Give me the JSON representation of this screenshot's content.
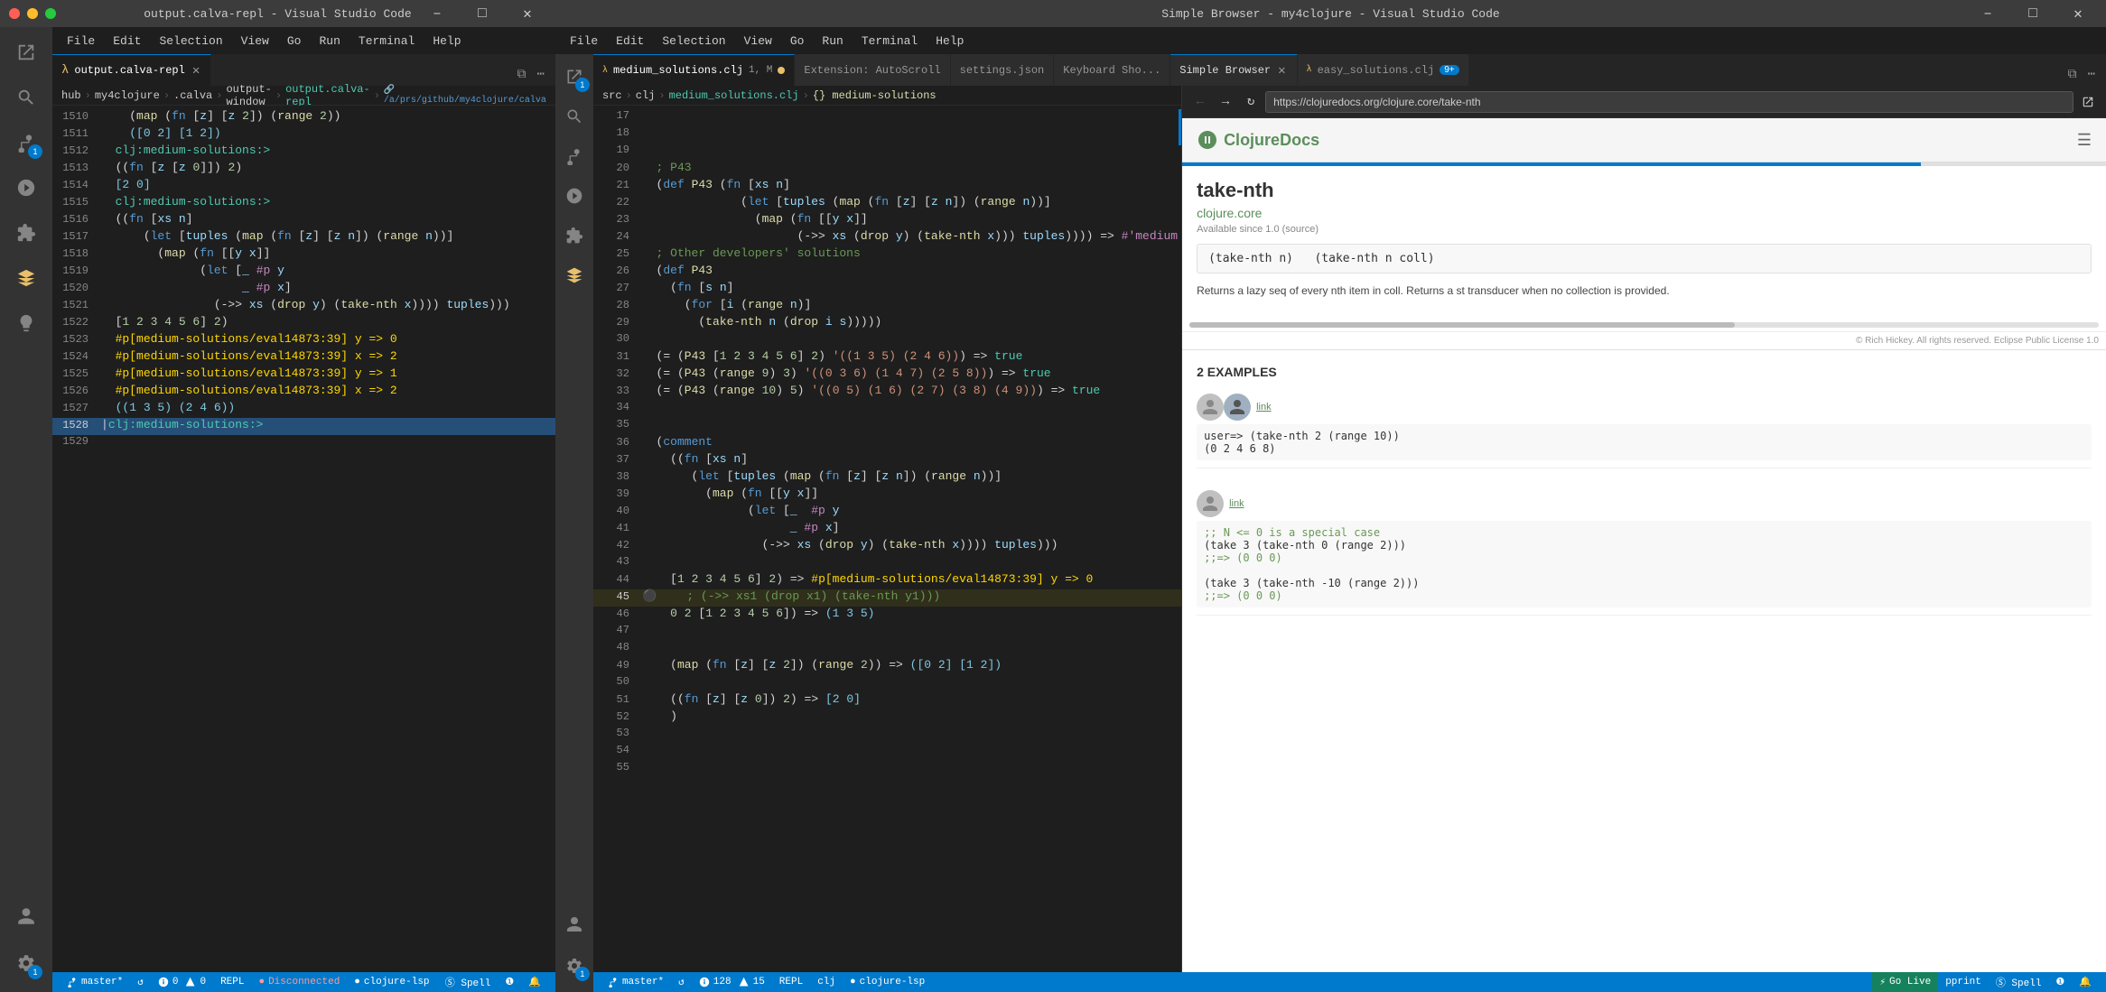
{
  "windows": {
    "left": {
      "title": "output.calva-repl - Visual Studio Code"
    },
    "right": {
      "title": "Simple Browser - my4clojure - Visual Studio Code"
    }
  },
  "menus": {
    "items": [
      "File",
      "Edit",
      "Selection",
      "View",
      "Go",
      "Run",
      "Terminal",
      "Help"
    ]
  },
  "left_tabs": [
    {
      "id": "output-calva-repl",
      "label": "output.calva-repl",
      "modified": false,
      "active": true
    }
  ],
  "right_tabs": [
    {
      "id": "medium-solutions",
      "label": "medium_solutions.clj",
      "info": "1, M",
      "modified": true,
      "active": true
    },
    {
      "id": "autoscroll",
      "label": "Extension: AutoScroll",
      "modified": false
    },
    {
      "id": "settings",
      "label": "settings.json",
      "modified": false
    },
    {
      "id": "keyboard",
      "label": "Keyboard Sho...",
      "modified": false
    },
    {
      "id": "simple-browser",
      "label": "Simple Browser",
      "active_secondary": true
    },
    {
      "id": "easy-solutions",
      "label": "easy_solutions.clj",
      "info": "9+"
    }
  ],
  "left_breadcrumb": [
    "hub",
    "my4clojure",
    ".calva",
    "output-window",
    "output.calva-repl"
  ],
  "center_breadcrumb": [
    "src",
    "clj",
    "medium_solutions.clj",
    "{} medium-solutions"
  ],
  "left_code": [
    {
      "num": "1510",
      "content": "    (map (fn [z] [z 2]) (range 2))"
    },
    {
      "num": "1511",
      "content": "    ([0 2] [1 2])"
    },
    {
      "num": "1512",
      "content": "  clj:medium-solutions:>"
    },
    {
      "num": "1513",
      "content": "  ((fn [z [z 0]]) 2)"
    },
    {
      "num": "1514",
      "content": "  [2 0]"
    },
    {
      "num": "1515",
      "content": "  clj:medium-solutions:>"
    },
    {
      "num": "1516",
      "content": "  ((fn [xs n]"
    },
    {
      "num": "1517",
      "content": "      (let [tuples (map (fn [z] [z n]) (range n))]"
    },
    {
      "num": "1518",
      "content": "        (map (fn [[y x]]"
    },
    {
      "num": "1519",
      "content": "              (let [_ #p y"
    },
    {
      "num": "1520",
      "content": "                    _ #p x]"
    },
    {
      "num": "1521",
      "content": "                (->> xs (drop y) (take-nth x)))) tuples)))"
    },
    {
      "num": "1522",
      "content": "  [1 2 3 4 5 6] 2)"
    },
    {
      "num": "1523",
      "content": "  #p[medium-solutions/eval14873:39] y => 0"
    },
    {
      "num": "1524",
      "content": "  #p[medium-solutions/eval14873:39] x => 2"
    },
    {
      "num": "1525",
      "content": "  #p[medium-solutions/eval14873:39] y => 1"
    },
    {
      "num": "1526",
      "content": "  #p[medium-solutions/eval14873:39] x => 2"
    },
    {
      "num": "1527",
      "content": "  ((1 3 5) (2 4 6))"
    },
    {
      "num": "1528",
      "content": "  clj:medium-solutions:>",
      "active_cursor": true
    },
    {
      "num": "1529",
      "content": ""
    }
  ],
  "center_code": [
    {
      "num": "17",
      "content": ""
    },
    {
      "num": "18",
      "content": ""
    },
    {
      "num": "19",
      "content": ""
    },
    {
      "num": "20",
      "content": "  ; P43"
    },
    {
      "num": "21",
      "content": "  (def P43 (fn [xs n]"
    },
    {
      "num": "22",
      "content": "              (let [tuples (map (fn [z] [z n]) (range n))]"
    },
    {
      "num": "23",
      "content": "                (map (fn [[y x]]"
    },
    {
      "num": "24",
      "content": "                      (->> xs (drop y) (take-nth x))) tuples)))) => #'medium"
    },
    {
      "num": "25",
      "content": "  ; Other developers' solutions"
    },
    {
      "num": "26",
      "content": "  (def P43"
    },
    {
      "num": "27",
      "content": "    (fn [s n]"
    },
    {
      "num": "28",
      "content": "      (for [i (range n)]"
    },
    {
      "num": "29",
      "content": "        (take-nth n (drop i s)))))"
    },
    {
      "num": "30",
      "content": ""
    },
    {
      "num": "31",
      "content": "  (= (P43 [1 2 3 4 5 6] 2) '((1 3 5) (2 4 6))) => true"
    },
    {
      "num": "32",
      "content": "  (= (P43 (range 9) 3) '((0 3 6) (1 4 7) (2 5 8))) => true"
    },
    {
      "num": "33",
      "content": "  (= (P43 (range 10) 5) '((0 5) (1 6) (2 7) (3 8) (4 9))) => true"
    },
    {
      "num": "34",
      "content": ""
    },
    {
      "num": "35",
      "content": ""
    },
    {
      "num": "36",
      "content": "  (comment"
    },
    {
      "num": "37",
      "content": "    ((fn [xs n]"
    },
    {
      "num": "38",
      "content": "       (let [tuples (map (fn [z] [z n]) (range n))]"
    },
    {
      "num": "39",
      "content": "         (map (fn [[y x]]"
    },
    {
      "num": "40",
      "content": "               (let [_  #p y"
    },
    {
      "num": "41",
      "content": "                     _ #p x]"
    },
    {
      "num": "42",
      "content": "                 (->> xs (drop y) (take-nth x)))) tuples)))"
    },
    {
      "num": "43",
      "content": ""
    },
    {
      "num": "44",
      "content": "    [1 2 3 4 5 6] 2) => #p[medium-solutions/eval14873:39] y => 0"
    },
    {
      "num": "45",
      "content": "    ; (->> xs1 (drop x1) (take-nth y1)))",
      "debug": true
    },
    {
      "num": "46",
      "content": "    0 2 [1 2 3 4 5 6]) => (1 3 5)"
    },
    {
      "num": "47",
      "content": ""
    },
    {
      "num": "48",
      "content": ""
    },
    {
      "num": "49",
      "content": "    (map (fn [z] [z 2]) (range 2)) => ([0 2] [1 2])"
    },
    {
      "num": "50",
      "content": ""
    },
    {
      "num": "51",
      "content": "    ((fn [z] [z 0]) 2) => [2 0]"
    },
    {
      "num": "52",
      "content": "    )"
    },
    {
      "num": "53",
      "content": ""
    },
    {
      "num": "54",
      "content": ""
    },
    {
      "num": "55",
      "content": ""
    }
  ],
  "browser": {
    "url": "https://clojuredocs.org/clojure.core/take-nth",
    "logo_text": "ClojureDocs",
    "fn_name": "take-nth",
    "ns_name": "clojure.core",
    "available": "Available since 1.0 (source)",
    "signature_1": "(take-nth n)",
    "signature_2": "(take-nth n coll)",
    "description": "Returns a lazy seq of every nth item in coll.  Returns a st transducer when no collection is provided.",
    "copyright": "© Rich Hickey. All rights reserved. Eclipse Public License 1.0",
    "examples_heading": "2 EXAMPLES",
    "examples": [
      {
        "id": 1,
        "link": "link",
        "code": "user=> (take-nth 2 (range 10))\n(0 2 4 6 8)"
      },
      {
        "id": 2,
        "link": "link",
        "code": ";; N <= 0 is a special case\n(take 3 (take-nth 0 (range 2)))\n;;=> (0 0 0)\n\n(take 3 (take-nth -10 (range 2)))\n;;=> (0 0 0)"
      }
    ]
  },
  "status_bar": {
    "branch": "master*",
    "sync": "",
    "errors": "0",
    "warnings": "0",
    "repl": "REPL",
    "disconnected": "Disconnected",
    "language": "clojure-lsp",
    "right_errors": "128",
    "right_warnings": "15",
    "right_repl": "REPL",
    "right_lang": "clj",
    "right_lsp": "clojure-lsp",
    "go_live": "Go Live",
    "pprint": "pprint",
    "spell": "Spell"
  }
}
